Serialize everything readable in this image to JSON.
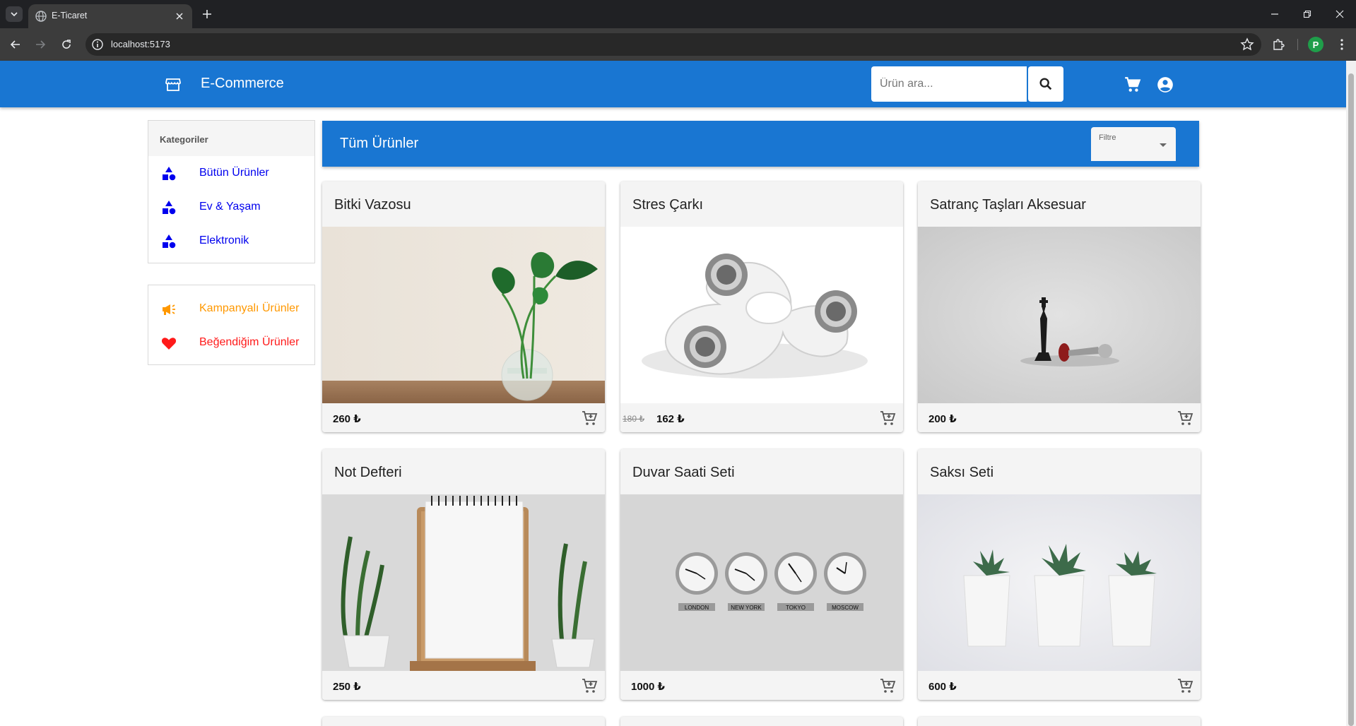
{
  "browser": {
    "tab_title": "E-Ticaret",
    "url": "localhost:5173",
    "profile_initial": "P"
  },
  "appbar": {
    "brand": "E-Commerce",
    "search_placeholder": "Ürün ara...",
    "color": "#1976d2"
  },
  "sidebar": {
    "categories_title": "Kategoriler",
    "categories": [
      {
        "label": "Bütün Ürünler",
        "icon": "category-shapes-icon"
      },
      {
        "label": "Ev & Yaşam",
        "icon": "category-shapes-icon"
      },
      {
        "label": "Elektronik",
        "icon": "category-shapes-icon"
      }
    ],
    "extras": [
      {
        "label": "Kampanyalı Ürünler",
        "icon": "megaphone-icon",
        "color": "#ff9800"
      },
      {
        "label": "Beğendiğim Ürünler",
        "icon": "heart-icon",
        "color": "#ff1a1a"
      }
    ]
  },
  "main": {
    "title": "Tüm Ürünler",
    "filter_label": "Filtre"
  },
  "products": [
    {
      "name": "Bitki Vazosu",
      "price": "260 ₺"
    },
    {
      "name": "Stres Çarkı",
      "old_price": "180 ₺",
      "price": "162 ₺"
    },
    {
      "name": "Satranç Taşları Aksesuar",
      "price": "200 ₺"
    },
    {
      "name": "Not Defteri",
      "price": "250 ₺"
    },
    {
      "name": "Duvar Saati Seti",
      "price": "1000 ₺",
      "clock_labels": [
        "LONDON",
        "NEW YORK",
        "TOKYO",
        "MOSCOW"
      ]
    },
    {
      "name": "Saksı Seti",
      "price": "600 ₺"
    }
  ]
}
